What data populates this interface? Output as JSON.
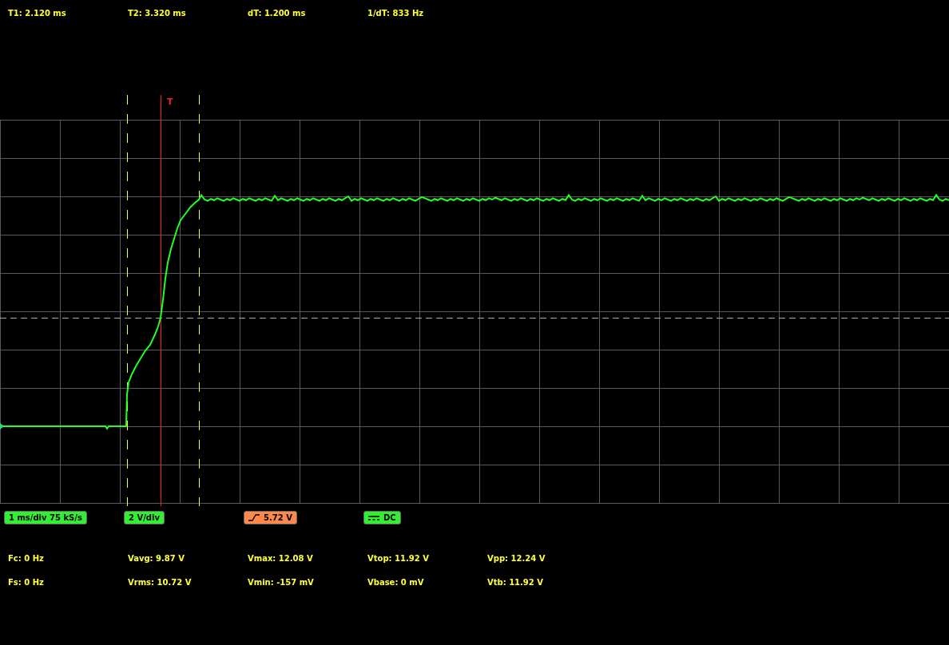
{
  "cursor_readouts": [
    "T1: 2.120 ms",
    "T2: 3.320 ms",
    "dT: 1.200 ms",
    "1/dT: 833 Hz"
  ],
  "plot": {
    "trigger_marker": "T"
  },
  "badges": [
    {
      "kind": "timebase",
      "text": "1 ms/div 75 kS/s"
    },
    {
      "kind": "scale",
      "text": "2 V/div"
    },
    {
      "kind": "trigger",
      "text": "5.72 V"
    },
    {
      "kind": "coupling",
      "text": "DC"
    }
  ],
  "measurements": [
    [
      "Fc: 0 Hz",
      "Vavg: 9.87 V",
      "Vmax: 12.08 V",
      "Vtop: 11.92 V",
      "Vpp: 12.24 V"
    ],
    [
      "Fs: 0 Hz",
      "Vrms: 10.72 V",
      "Vmin: -157 mV",
      "Vbase: 0 mV",
      "Vtb: 11.92 V"
    ]
  ]
}
